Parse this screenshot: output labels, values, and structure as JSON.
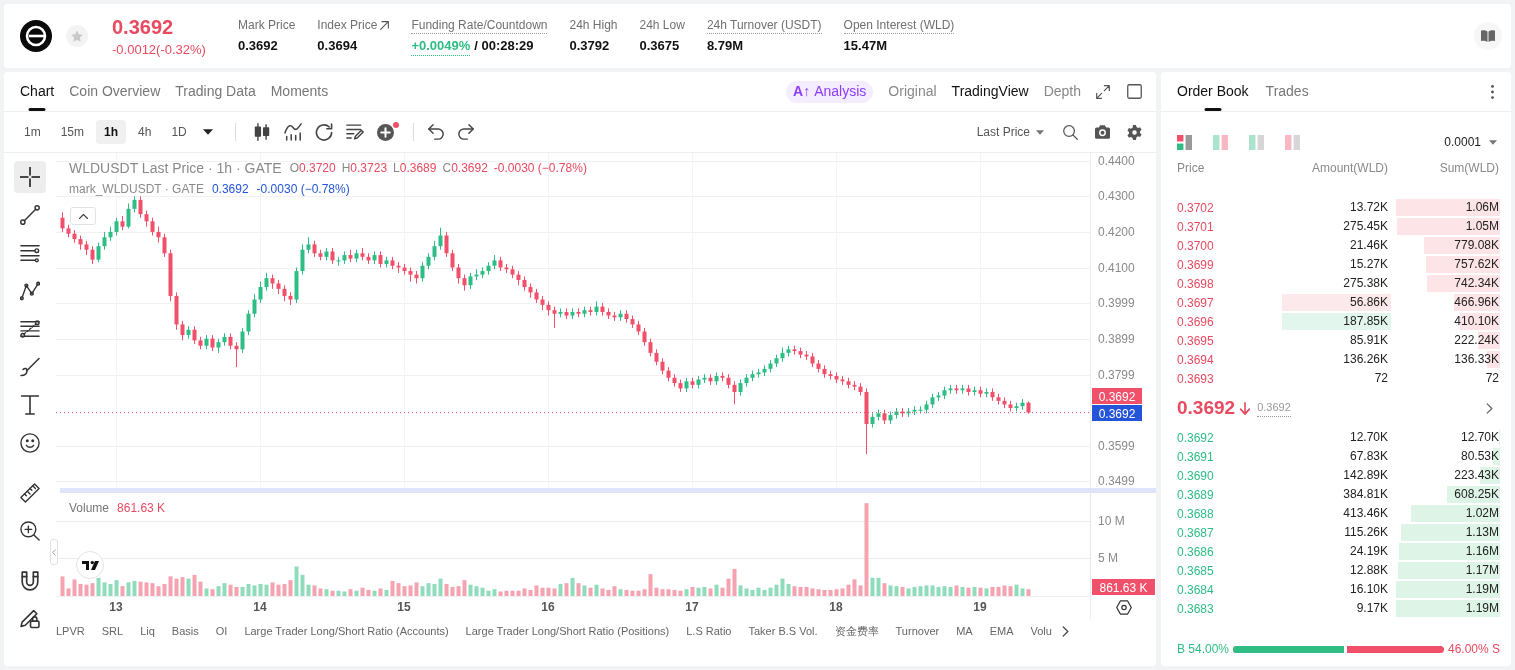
{
  "header": {
    "price": "0.3692",
    "change": "-0.0012(-0.32%)",
    "falling": true,
    "stats": [
      {
        "label": "Mark Price",
        "value": "0.3692",
        "kind": "plain",
        "underlined": false
      },
      {
        "label": "Index Price",
        "value": "0.3694",
        "kind": "link",
        "underlined": false
      },
      {
        "label": "Funding Rate/Countdown",
        "value": "+0.0049%",
        "countdown": "/ 00:28:29",
        "kind": "funding",
        "underlined": true
      },
      {
        "label": "24h High",
        "value": "0.3792",
        "kind": "plain",
        "underlined": false
      },
      {
        "label": "24h Low",
        "value": "0.3675",
        "kind": "plain",
        "underlined": false
      },
      {
        "label": "24h Turnover (USDT)",
        "value": "8.79M",
        "kind": "plain",
        "underlined": true
      },
      {
        "label": "Open Interest (WLD)",
        "value": "15.47M",
        "kind": "plain",
        "underlined": true
      }
    ]
  },
  "chart_panel": {
    "tabs": [
      {
        "label": "Chart",
        "selected": true
      },
      {
        "label": "Coin Overview",
        "selected": false
      },
      {
        "label": "Trading Data",
        "selected": false
      },
      {
        "label": "Moments",
        "selected": false
      }
    ],
    "views": [
      {
        "label": "Analysis",
        "prefix": "A↑",
        "kind": "ai",
        "selected": false
      },
      {
        "label": "Original",
        "kind": "plain",
        "selected": false
      },
      {
        "label": "TradingView",
        "kind": "plain",
        "selected": true
      },
      {
        "label": "Depth",
        "kind": "plain",
        "selected": false
      }
    ],
    "intervals": [
      {
        "label": "1m",
        "selected": false
      },
      {
        "label": "15m",
        "selected": false
      },
      {
        "label": "1h",
        "selected": true
      },
      {
        "label": "4h",
        "selected": false
      },
      {
        "label": "1D",
        "selected": false
      }
    ],
    "indicator_update_dot": true,
    "price_source": "Last Price",
    "drawing_tool_groups": [
      [
        {
          "kind": "crosshair",
          "selected": true
        },
        {
          "kind": "trend-line",
          "selected": false
        },
        {
          "kind": "horizontal-lines",
          "selected": false
        },
        {
          "kind": "pattern",
          "selected": false
        },
        {
          "kind": "fibonacci",
          "selected": false
        },
        {
          "kind": "brush",
          "selected": false
        },
        {
          "kind": "text",
          "selected": false
        },
        {
          "kind": "emoji",
          "selected": false
        }
      ],
      [
        {
          "kind": "ruler",
          "selected": false
        },
        {
          "kind": "zoom-in",
          "selected": false
        }
      ],
      [
        {
          "kind": "magnet",
          "selected": false
        },
        {
          "kind": "pencil-lock",
          "selected": false
        }
      ]
    ],
    "legend": {
      "title": "WLDUSDT Last Price · 1h · GATE",
      "ohlc": [
        {
          "key": "O",
          "value": "0.3720"
        },
        {
          "key": "H",
          "value": "0.3723"
        },
        {
          "key": "L",
          "value": "0.3689"
        },
        {
          "key": "C",
          "value": "0.3692"
        }
      ],
      "change": "-0.0030 (−0.78%)",
      "mark_title": "mark_WLDUSDT · GATE",
      "mark_value": "0.3692",
      "mark_change": "-0.0030 (−0.78%)"
    },
    "price_chart": {
      "last_tag": "0.3692",
      "mark_tag": "0.3692",
      "axis_labels": [
        "0.4400",
        "0.4300",
        "0.4200",
        "0.4100",
        "0.3999",
        "0.3899",
        "0.3799",
        "0.3599",
        "0.3499"
      ]
    },
    "volume_chart": {
      "label": "Volume",
      "value": "861.63 K",
      "last_tag": "861.63 K",
      "chart_data": {
        "type": "bar",
        "grid": true,
        "xlim": [
          12.5833,
          19.7639
        ],
        "ylim": [
          0,
          13.65
        ],
        "x": [
          12.625,
          12.6667,
          12.7083,
          12.75,
          12.7917,
          12.8333,
          12.875,
          12.9167,
          12.9583,
          13,
          13.0417,
          13.0833,
          13.125,
          13.1667,
          13.2083,
          13.25,
          13.2917,
          13.3333,
          13.375,
          13.4167,
          13.4583,
          13.5,
          13.5417,
          13.5833,
          13.625,
          13.6667,
          13.7083,
          13.75,
          13.7917,
          13.8333,
          13.875,
          13.9167,
          13.9583,
          14,
          14.0417,
          14.0833,
          14.125,
          14.1667,
          14.2083,
          14.25,
          14.2917,
          14.3333,
          14.375,
          14.4167,
          14.4583,
          14.5,
          14.5417,
          14.5833,
          14.625,
          14.6667,
          14.7083,
          14.75,
          14.7917,
          14.8333,
          14.875,
          14.9167,
          14.9583,
          15,
          15.0417,
          15.0833,
          15.125,
          15.1667,
          15.2083,
          15.25,
          15.2917,
          15.3333,
          15.375,
          15.4167,
          15.4583,
          15.5,
          15.5417,
          15.5833,
          15.625,
          15.6667,
          15.7083,
          15.75,
          15.7917,
          15.8333,
          15.875,
          15.9167,
          15.9583,
          16,
          16.0417,
          16.0833,
          16.125,
          16.1667,
          16.2083,
          16.25,
          16.2917,
          16.3333,
          16.375,
          16.4167,
          16.4583,
          16.5,
          16.5417,
          16.5833,
          16.625,
          16.6667,
          16.7083,
          16.75,
          16.7917,
          16.8333,
          16.875,
          16.9167,
          16.9583,
          17,
          17.0417,
          17.0833,
          17.125,
          17.1667,
          17.2083,
          17.25,
          17.2917,
          17.3333,
          17.375,
          17.4167,
          17.4583,
          17.5,
          17.5417,
          17.5833,
          17.625,
          17.6667,
          17.7083,
          17.75,
          17.7917,
          17.8333,
          17.875,
          17.9167,
          17.9583,
          18,
          18.0417,
          18.0833,
          18.125,
          18.1667,
          18.2083,
          18.25,
          18.2917,
          18.3333,
          18.375,
          18.4167,
          18.4583,
          18.5,
          18.5417,
          18.5833,
          18.625,
          18.6667,
          18.7083,
          18.75,
          18.7917,
          18.8333,
          18.875,
          18.9167,
          18.9583,
          19,
          19.0417,
          19.0833,
          19.125,
          19.1667,
          19.2083,
          19.25,
          19.2917,
          19.3333
        ],
        "xticks": [
          {
            "value": 13,
            "label": "13"
          },
          {
            "value": 14,
            "label": "14"
          },
          {
            "value": 15,
            "label": "15"
          },
          {
            "value": 16,
            "label": "16"
          },
          {
            "value": 17,
            "label": "17"
          },
          {
            "value": 18,
            "label": "18"
          },
          {
            "value": 19,
            "label": "19"
          }
        ],
        "yticks": [
          {
            "value": 5,
            "label": "5 M"
          },
          {
            "value": 10,
            "label": "10 M"
          }
        ],
        "series": [
          {
            "color": "#8fdcbc",
            "values": [
              null,
              null,
              null,
              null,
              null,
              null,
              2.4,
              1.8,
              1.6,
              2.1,
              null,
              1.8,
              2.0,
              null,
              null,
              null,
              null,
              null,
              null,
              null,
              null,
              2.3,
              null,
              null,
              1.0,
              null,
              1.3,
              1.7,
              null,
              null,
              1.2,
              1.6,
              1.4,
              1.6,
              1.5,
              null,
              null,
              null,
              null,
              3.9,
              2.8,
              1.5,
              null,
              null,
              0.9,
              null,
              0.7,
              0.6,
              null,
              0.7,
              null,
              null,
              0.7,
              null,
              0.8,
              null,
              null,
              null,
              null,
              null,
              1.3,
              1.7,
              1.6,
              2.3,
              null,
              null,
              null,
              null,
              1.5,
              1.3,
              1.1,
              0.7,
              0.9,
              null,
              null,
              null,
              null,
              null,
              null,
              null,
              null,
              null,
              null,
              1.6,
              null,
              2.4,
              null,
              1.4,
              null,
              1.5,
              null,
              null,
              null,
              0.9,
              null,
              null,
              null,
              null,
              null,
              null,
              null,
              null,
              null,
              null,
              0.9,
              null,
              1.1,
              1.2,
              null,
              1.5,
              null,
              null,
              null,
              1.4,
              1.0,
              0.8,
              1.1,
              0.8,
              1.1,
              1.5,
              2.3,
              1.6,
              null,
              null,
              null,
              null,
              null,
              null,
              null,
              null,
              null,
              null,
              null,
              null,
              null,
              2.4,
              2.4,
              null,
              1.4,
              1.3,
              null,
              1.0,
              1.2,
              1.3,
              1.4,
              1.4,
              1.2,
              1.3,
              1.2,
              null,
              1.2,
              null,
              1.2,
              null,
              1.0,
              null,
              null,
              null,
              null,
              1.5,
              1.0,
              null
            ]
          },
          {
            "color": "#f5a3b0",
            "values": [
              2.6,
              1.0,
              2.2,
              1.6,
              1.5,
              1.7,
              null,
              null,
              null,
              null,
              1.3,
              null,
              null,
              1.9,
              1.8,
              1.7,
              1.3,
              1.6,
              2.6,
              2.3,
              2.5,
              null,
              2.8,
              1.9,
              null,
              0.9,
              null,
              null,
              1.5,
              1.2,
              null,
              null,
              null,
              null,
              null,
              1.8,
              1.5,
              1.6,
              2.1,
              null,
              null,
              null,
              1.4,
              1.0,
              null,
              0.7,
              null,
              null,
              0.9,
              null,
              1.1,
              0.8,
              null,
              1.0,
              null,
              2.0,
              1.7,
              1.3,
              1.4,
              1.8,
              null,
              null,
              null,
              null,
              1.6,
              1.2,
              1.3,
              2.1,
              null,
              null,
              null,
              null,
              null,
              0.6,
              0.7,
              0.7,
              0.7,
              1.0,
              0.8,
              1.4,
              1.1,
              1.1,
              1.0,
              null,
              1.7,
              null,
              1.7,
              null,
              1.1,
              null,
              1.0,
              0.8,
              1.3,
              null,
              0.8,
              0.7,
              0.7,
              0.9,
              2.9,
              1.1,
              0.9,
              0.9,
              0.8,
              0.7,
              null,
              1.2,
              null,
              null,
              1.0,
              null,
              1.1,
              2.3,
              3.6,
              null,
              null,
              null,
              null,
              null,
              null,
              null,
              null,
              null,
              1.3,
              1.2,
              1.2,
              1.0,
              0.9,
              0.8,
              0.8,
              0.9,
              1.0,
              1.5,
              2.2,
              1.4,
              12.3,
              null,
              null,
              1.7,
              null,
              null,
              1.2,
              null,
              null,
              null,
              null,
              null,
              null,
              null,
              null,
              1.4,
              null,
              1.1,
              null,
              1.1,
              null,
              1.2,
              1.2,
              1.4,
              1.3,
              null,
              null,
              0.9
            ]
          }
        ]
      }
    },
    "indicators": [
      "LPVR",
      "SRL",
      "Liq",
      "Basis",
      "OI",
      "Large Trader Long/Short Ratio (Accounts)",
      "Large Trader Long/Short Ratio (Positions)",
      "L.S Ratio",
      "Taker B.S Vol.",
      "资金费率",
      "Turnover",
      "MA",
      "EMA",
      "Volu"
    ]
  },
  "order_book": {
    "tabs": [
      {
        "label": "Order Book",
        "selected": true
      },
      {
        "label": "Trades",
        "selected": false
      }
    ],
    "layouts": [
      {
        "kind": "both",
        "selected": true
      },
      {
        "kind": "split",
        "selected": false
      },
      {
        "kind": "bids",
        "selected": false
      },
      {
        "kind": "asks",
        "selected": false
      }
    ],
    "precision": "0.0001",
    "columns": [
      "Price",
      "Amount(WLD)",
      "Sum(WLD)"
    ],
    "asks": [
      {
        "price": "0.3702",
        "amount": "13.72K",
        "sum": "1.06M",
        "level": 1.0
      },
      {
        "price": "0.3701",
        "amount": "275.45K",
        "sum": "1.05M",
        "level": 0.99
      },
      {
        "price": "0.3700",
        "amount": "21.46K",
        "sum": "779.08K",
        "level": 0.735
      },
      {
        "price": "0.3699",
        "amount": "15.27K",
        "sum": "757.62K",
        "level": 0.715
      },
      {
        "price": "0.3698",
        "amount": "275.38K",
        "sum": "742.34K",
        "level": 0.7
      },
      {
        "price": "0.3697",
        "amount": "56.86K",
        "sum": "466.96K",
        "level": 0.44,
        "color": "#fce9eb"
      },
      {
        "price": "0.3696",
        "amount": "187.85K",
        "sum": "410.10K",
        "level": 0.387,
        "color": "#e2f6ed"
      },
      {
        "price": "0.3695",
        "amount": "85.91K",
        "sum": "222.24K",
        "level": 0.21
      },
      {
        "price": "0.3694",
        "amount": "136.26K",
        "sum": "136.33K",
        "level": 0.129
      },
      {
        "price": "0.3693",
        "amount": "72",
        "sum": "72"
      }
    ],
    "last_price": {
      "price": "0.3692",
      "falling": true,
      "mark": "0.3692"
    },
    "bids": [
      {
        "price": "0.3692",
        "amount": "12.70K",
        "sum": "12.70K",
        "level": 0.011
      },
      {
        "price": "0.3691",
        "amount": "67.83K",
        "sum": "80.53K",
        "level": 0.068
      },
      {
        "price": "0.3690",
        "amount": "142.89K",
        "sum": "223.43K",
        "level": 0.188
      },
      {
        "price": "0.3689",
        "amount": "384.81K",
        "sum": "608.25K",
        "level": 0.511
      },
      {
        "price": "0.3688",
        "amount": "413.46K",
        "sum": "1.02M",
        "level": 0.857
      },
      {
        "price": "0.3687",
        "amount": "115.26K",
        "sum": "1.13M",
        "level": 0.95
      },
      {
        "price": "0.3686",
        "amount": "24.19K",
        "sum": "1.16M",
        "level": 0.975
      },
      {
        "price": "0.3685",
        "amount": "12.88K",
        "sum": "1.17M",
        "level": 0.983
      },
      {
        "price": "0.3684",
        "amount": "16.10K",
        "sum": "1.19M",
        "level": 1.0
      },
      {
        "price": "0.3683",
        "amount": "9.17K",
        "sum": "1.19M",
        "level": 1.0
      }
    ],
    "ratio": {
      "buy": "B 54.00%",
      "sell": "46.00% S",
      "level": 0.54
    }
  }
}
